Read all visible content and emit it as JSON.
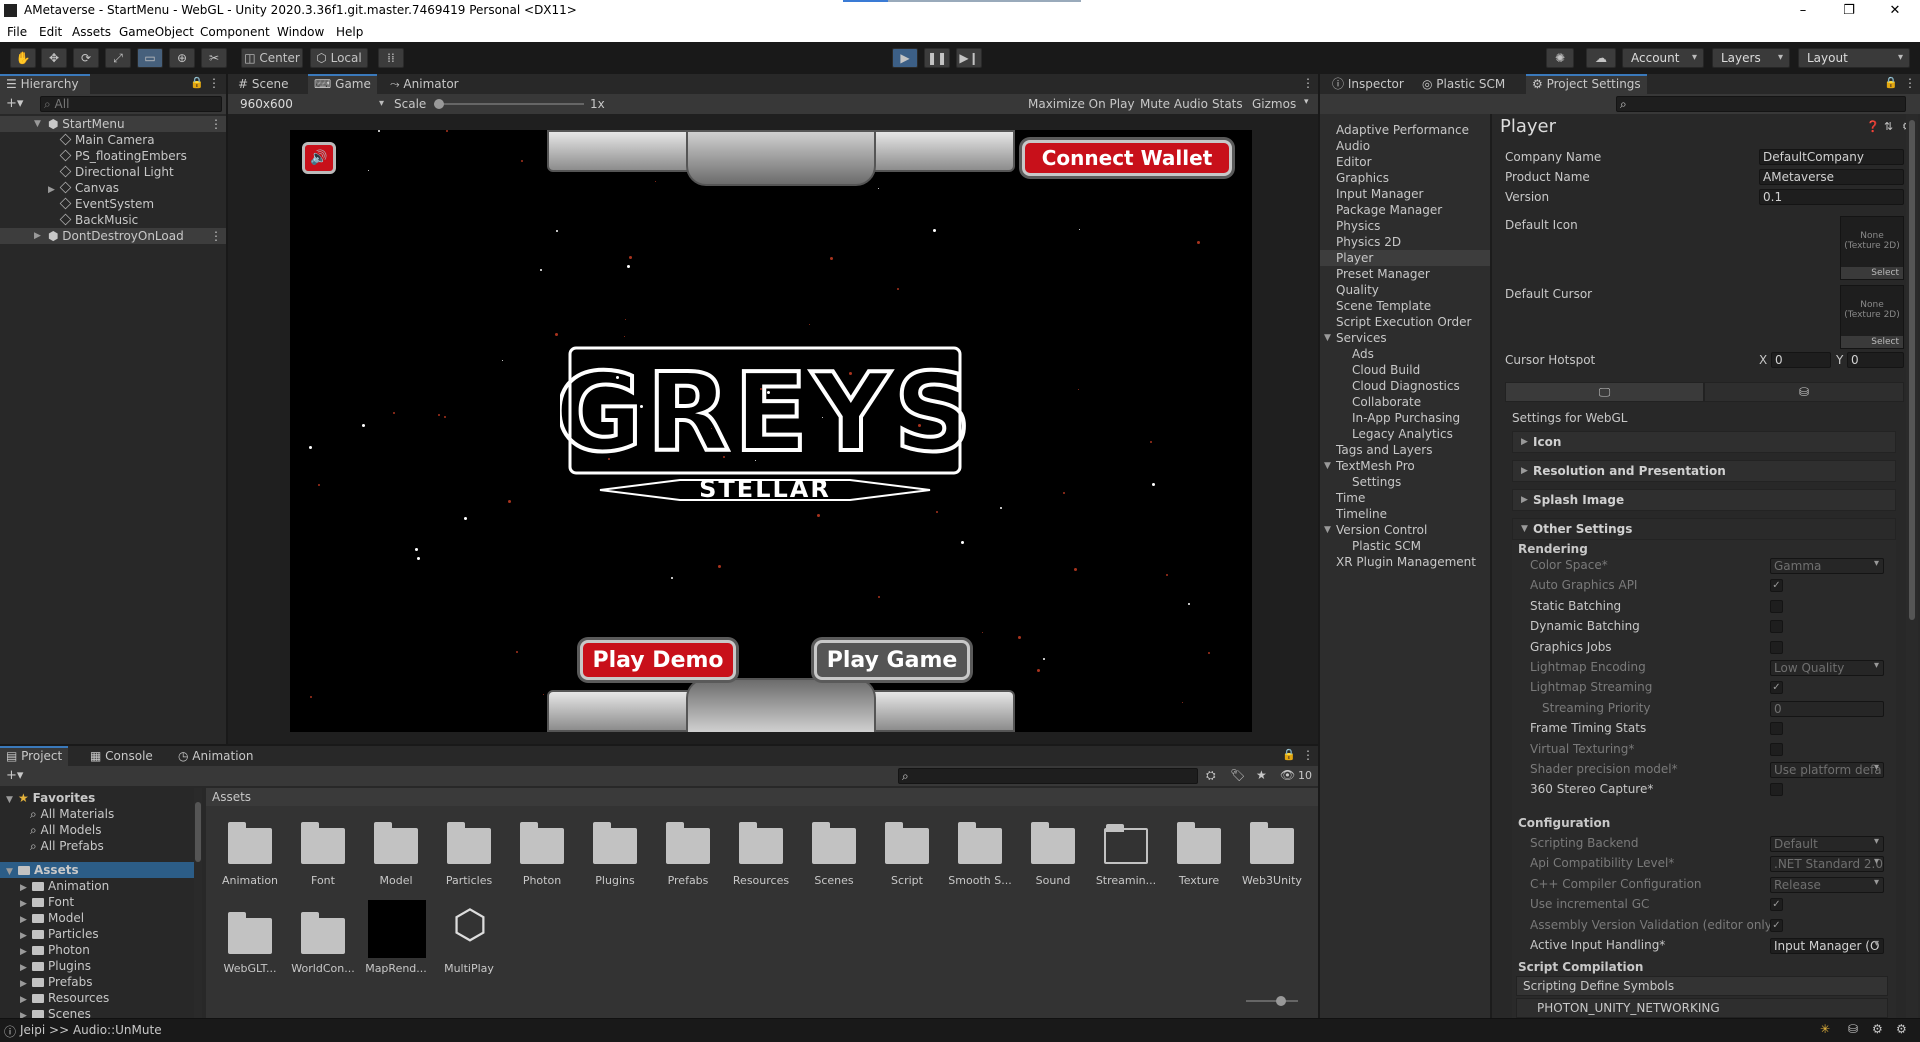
{
  "window": {
    "title": "AMetaverse - StartMenu - WebGL - Unity 2020.3.36f1.git.master.7469419 Personal <DX11>",
    "minimize": "–",
    "maximize": "❐",
    "close": "✕"
  },
  "menubar": [
    "File",
    "Edit",
    "Assets",
    "GameObject",
    "Component",
    "Window",
    "Help"
  ],
  "toolbar": {
    "pivot_label": "Center",
    "space_label": "Local",
    "account_label": "Account",
    "layers_label": "Layers",
    "layout_label": "Layout"
  },
  "hierarchy": {
    "tab_label": "Hierarchy",
    "search_placeholder": "All",
    "scene": "StartMenu",
    "items": [
      "Main Camera",
      "PS_floatingEmbers",
      "Directional Light",
      "Canvas",
      "EventSystem",
      "BackMusic"
    ],
    "dont_destroy": "DontDestroyOnLoad"
  },
  "scene_tabs": [
    "Scene",
    "Game",
    "Animator"
  ],
  "game_toolbar": {
    "resolution": "960x600",
    "scale_label": "Scale",
    "scale_value": "1x",
    "maximize": "Maximize On Play",
    "mute": "Mute Audio",
    "stats": "Stats",
    "gizmos": "Gizmos"
  },
  "game": {
    "connect_wallet": "Connect Wallet",
    "play_demo": "Play Demo",
    "play_game": "Play Game",
    "logo_text": "GREYS",
    "logo_sub": "STELLAR",
    "colors": {
      "red_button": "#c8101a",
      "ember": "#a8331d"
    }
  },
  "inspector_tabs": [
    "Inspector",
    "Plastic SCM",
    "Project Settings"
  ],
  "settings_nav": [
    {
      "label": "Adaptive Performance",
      "indent": 0
    },
    {
      "label": "Audio",
      "indent": 0
    },
    {
      "label": "Editor",
      "indent": 0
    },
    {
      "label": "Graphics",
      "indent": 0
    },
    {
      "label": "Input Manager",
      "indent": 0
    },
    {
      "label": "Package Manager",
      "indent": 0
    },
    {
      "label": "Physics",
      "indent": 0
    },
    {
      "label": "Physics 2D",
      "indent": 0
    },
    {
      "label": "Player",
      "indent": 0,
      "selected": true
    },
    {
      "label": "Preset Manager",
      "indent": 0
    },
    {
      "label": "Quality",
      "indent": 0
    },
    {
      "label": "Scene Template",
      "indent": 0
    },
    {
      "label": "Script Execution Order",
      "indent": 0
    },
    {
      "label": "Services",
      "indent": 0,
      "expanded": true
    },
    {
      "label": "Ads",
      "indent": 1
    },
    {
      "label": "Cloud Build",
      "indent": 1
    },
    {
      "label": "Cloud Diagnostics",
      "indent": 1
    },
    {
      "label": "Collaborate",
      "indent": 1
    },
    {
      "label": "In-App Purchasing",
      "indent": 1
    },
    {
      "label": "Legacy Analytics",
      "indent": 1
    },
    {
      "label": "Tags and Layers",
      "indent": 0
    },
    {
      "label": "TextMesh Pro",
      "indent": 0,
      "expanded": true
    },
    {
      "label": "Settings",
      "indent": 1
    },
    {
      "label": "Time",
      "indent": 0
    },
    {
      "label": "Timeline",
      "indent": 0
    },
    {
      "label": "Version Control",
      "indent": 0,
      "expanded": true
    },
    {
      "label": "Plastic SCM",
      "indent": 1
    },
    {
      "label": "XR Plugin Management",
      "indent": 0
    }
  ],
  "player": {
    "heading": "Player",
    "company_label": "Company Name",
    "company_value": "DefaultCompany",
    "product_label": "Product Name",
    "product_value": "AMetaverse",
    "version_label": "Version",
    "version_value": "0.1",
    "default_icon_label": "Default Icon",
    "default_cursor_label": "Default Cursor",
    "texture_none": "None\n(Texture 2D)",
    "select_label": "Select",
    "hotspot_label": "Cursor Hotspot",
    "hotspot_x_label": "X",
    "hotspot_x": "0",
    "hotspot_y_label": "Y",
    "hotspot_y": "0",
    "settings_for": "Settings for WebGL",
    "foldouts": [
      "Icon",
      "Resolution and Presentation",
      "Splash Image",
      "Other Settings"
    ],
    "rendering_header": "Rendering",
    "rendering": [
      {
        "label": "Color Space*",
        "dim": true,
        "type": "dropdown",
        "value": "Gamma"
      },
      {
        "label": "Auto Graphics API",
        "dim": true,
        "type": "check",
        "checked": true
      },
      {
        "label": "Static Batching",
        "dim": false,
        "type": "check",
        "checked": false
      },
      {
        "label": "Dynamic Batching",
        "dim": false,
        "type": "check",
        "checked": false
      },
      {
        "label": "Graphics Jobs",
        "dim": false,
        "type": "check",
        "checked": false
      },
      {
        "label": "Lightmap Encoding",
        "dim": true,
        "type": "dropdown",
        "value": "Low Quality"
      },
      {
        "label": "Lightmap Streaming",
        "dim": true,
        "type": "check",
        "checked": true
      },
      {
        "label": "Streaming Priority",
        "dim": true,
        "type": "text",
        "value": "0",
        "indent": true
      },
      {
        "label": "Frame Timing Stats",
        "dim": false,
        "type": "check",
        "checked": false
      },
      {
        "label": "Virtual Texturing*",
        "dim": true,
        "type": "check",
        "checked": false
      },
      {
        "label": "Shader precision model*",
        "dim": true,
        "type": "dropdown",
        "value": "Use platform defa"
      },
      {
        "label": "360 Stereo Capture*",
        "dim": false,
        "type": "check",
        "checked": false
      }
    ],
    "configuration_header": "Configuration",
    "configuration": [
      {
        "label": "Scripting Backend",
        "dim": true,
        "type": "dropdown",
        "value": "Default"
      },
      {
        "label": "Api Compatibility Level*",
        "dim": true,
        "type": "dropdown",
        "value": ".NET Standard 2.0"
      },
      {
        "label": "C++ Compiler Configuration",
        "dim": true,
        "type": "dropdown",
        "value": "Release"
      },
      {
        "label": "Use incremental GC",
        "dim": true,
        "type": "check",
        "checked": true
      },
      {
        "label": "Assembly Version Validation (editor only)",
        "dim": true,
        "type": "check",
        "checked": true
      },
      {
        "label": "Active Input Handling*",
        "dim": false,
        "type": "dropdown",
        "value": "Input Manager (O"
      }
    ],
    "script_compilation_header": "Script Compilation",
    "define_symbols_label": "Scripting Define Symbols",
    "define_symbol": "PHOTON_UNITY_NETWORKING"
  },
  "bottom_tabs": [
    "Project",
    "Console",
    "Animation"
  ],
  "project": {
    "favorites_label": "Favorites",
    "favorites": [
      "All Materials",
      "All Models",
      "All Prefabs"
    ],
    "assets_label": "Assets",
    "tree": [
      "Animation",
      "Font",
      "Model",
      "Particles",
      "Photon",
      "Plugins",
      "Prefabs",
      "Resources",
      "Scenes"
    ],
    "breadcrumb": "Assets",
    "hidden_count": "10",
    "grid_row1": [
      "Animation",
      "Font",
      "Model",
      "Particles",
      "Photon",
      "Plugins",
      "Prefabs",
      "Resources",
      "Scenes",
      "Script",
      "Smooth S...",
      "Sound",
      "Streamin...",
      "Texture",
      "Web3Unity"
    ],
    "grid_row2": [
      "WebGLT...",
      "WorldCon...",
      "MapRend...",
      "MultiPlay"
    ]
  },
  "statusbar": {
    "message": "Jeipi >> Audio::UnMute"
  }
}
